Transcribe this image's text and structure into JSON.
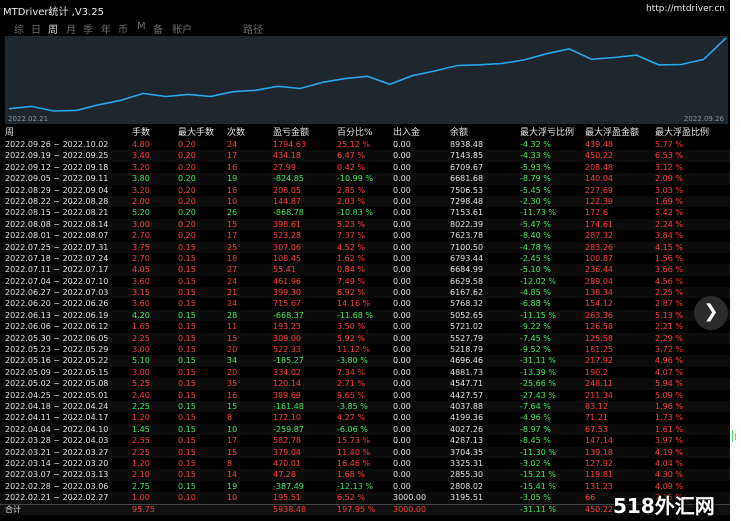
{
  "window": {
    "title": "MTDriver统计 ,V3.25",
    "url": "http://mtdriver.cn"
  },
  "tabs": [
    "综",
    "日",
    "周",
    "月",
    "季",
    "年",
    "币",
    "M",
    "备",
    "账户",
    "",
    "路径"
  ],
  "active_tab": 2,
  "chart": {
    "start_date": "2022.02.21",
    "end_date": "2022.09.26",
    "line_color": "#2aa7e8"
  },
  "headers": [
    "周",
    "手数",
    "最大手数",
    "次数",
    "盈亏金额",
    "百分比%",
    "出入金",
    "余额",
    "最大浮亏比例",
    "最大浮盈金额",
    "最大浮盈比例"
  ],
  "rows": [
    [
      "2022.09.26 ~ 2022.10.02",
      "4.80",
      "0.20",
      "24",
      "1794.63",
      "25.12 %",
      "0.00",
      "8938.48",
      "-4.32 %",
      "439.48",
      "5.77 %"
    ],
    [
      "2022.09.19 ~ 2022.09.25",
      "3.40",
      "0.20",
      "17",
      "434.18",
      "6.47 %",
      "0.00",
      "7143.85",
      "-4.33 %",
      "450.22",
      "6.53 %"
    ],
    [
      "2022.09.12 ~ 2022.09.18",
      "3.20",
      "0.20",
      "16",
      "27.99",
      "0.42 %",
      "0.00",
      "6709.67",
      "-5.93 %",
      "208.48",
      "3.12 %"
    ],
    [
      "2022.09.05 ~ 2022.09.11",
      "3.80",
      "0.20",
      "19",
      "-824.85",
      "-10.99 %",
      "0.00",
      "6681.68",
      "-8.79 %",
      "140.04",
      "2.09 %"
    ],
    [
      "2022.08.29 ~ 2022.09.04",
      "3.20",
      "0.20",
      "16",
      "208.05",
      "2.85 %",
      "0.00",
      "7506.53",
      "-5.45 %",
      "227.69",
      "3.03 %"
    ],
    [
      "2022.08.22 ~ 2022.08.28",
      "2.00",
      "0.20",
      "10",
      "144.87",
      "2.03 %",
      "0.00",
      "7298.48",
      "-2.30 %",
      "122.39",
      "1.69 %"
    ],
    [
      "2022.08.15 ~ 2022.08.21",
      "5.20",
      "0.20",
      "26",
      "-868.78",
      "-10.83 %",
      "0.00",
      "7153.61",
      "-11.73 %",
      "172.6",
      "2.42 %"
    ],
    [
      "2022.08.08 ~ 2022.08.14",
      "3.00",
      "0.20",
      "15",
      "398.61",
      "5.23 %",
      "0.00",
      "8022.39",
      "-5.47 %",
      "174.61",
      "2.24 %"
    ],
    [
      "2022.08.01 ~ 2022.08.07",
      "2.70",
      "0.20",
      "17",
      "523.28",
      "7.37 %",
      "0.00",
      "7623.78",
      "-8.40 %",
      "287.32",
      "3.84 %"
    ],
    [
      "2022.07.25 ~ 2022.07.31",
      "3.75",
      "0.15",
      "25",
      "307.06",
      "4.52 %",
      "0.00",
      "7100.50",
      "-4.78 %",
      "283.26",
      "4.15 %"
    ],
    [
      "2022.07.18 ~ 2022.07.24",
      "2.70",
      "0.15",
      "18",
      "108.45",
      "1.62 %",
      "0.00",
      "6793.44",
      "-2.45 %",
      "100.87",
      "1.56 %"
    ],
    [
      "2022.07.11 ~ 2022.07.17",
      "4.05",
      "0.15",
      "27",
      "55.41",
      "0.84 %",
      "0.00",
      "6684.99",
      "-5.10 %",
      "236.44",
      "3.66 %"
    ],
    [
      "2022.07.04 ~ 2022.07.10",
      "3.60",
      "0.15",
      "24",
      "461.96",
      "7.49 %",
      "0.00",
      "6629.58",
      "-12.02 %",
      "289.04",
      "4.56 %"
    ],
    [
      "2022.06.27 ~ 2022.07.03",
      "3.15",
      "0.15",
      "21",
      "399.30",
      "6.92 %",
      "0.00",
      "6167.62",
      "-4.85 %",
      "138.34",
      "2.25 %"
    ],
    [
      "2022.06.20 ~ 2022.06.26",
      "3.60",
      "0.15",
      "24",
      "715.67",
      "14.16 %",
      "0.00",
      "5768.32",
      "-6.88 %",
      "154.12",
      "2.87 %"
    ],
    [
      "2022.06.13 ~ 2022.06.19",
      "4.20",
      "0.15",
      "28",
      "-668.37",
      "-11.68 %",
      "0.00",
      "5052.65",
      "-11.15 %",
      "263.36",
      "5.13 %"
    ],
    [
      "2022.06.06 ~ 2022.06.12",
      "1.65",
      "0.15",
      "11",
      "193.23",
      "3.50 %",
      "0.00",
      "5721.02",
      "-9.22 %",
      "126.58",
      "2.21 %"
    ],
    [
      "2022.05.30 ~ 2022.06.05",
      "2.25",
      "0.15",
      "15",
      "309.00",
      "5.92 %",
      "0.00",
      "5527.79",
      "-7.45 %",
      "125.58",
      "2.29 %"
    ],
    [
      "2022.05.23 ~ 2022.05.29",
      "3.00",
      "0.15",
      "20",
      "522.33",
      "11.12 %",
      "0.00",
      "5218.79",
      "-9.52 %",
      "181.25",
      "3.72 %"
    ],
    [
      "2022.05.16 ~ 2022.05.22",
      "5.10",
      "0.15",
      "34",
      "-185.27",
      "-3.80 %",
      "0.00",
      "4696.46",
      "-31.11 %",
      "217.92",
      "4.96 %"
    ],
    [
      "2022.05.09 ~ 2022.05.15",
      "3.00",
      "0.15",
      "20",
      "334.02",
      "7.34 %",
      "0.00",
      "4881.73",
      "-13.39 %",
      "190.2",
      "4.07 %"
    ],
    [
      "2022.05.02 ~ 2022.05.08",
      "5.25",
      "0.15",
      "35",
      "120.14",
      "2.71 %",
      "0.00",
      "4547.71",
      "-25.66 %",
      "248.11",
      "5.94 %"
    ],
    [
      "2022.04.25 ~ 2022.05.01",
      "2.40",
      "0.15",
      "16",
      "389.69",
      "9.65 %",
      "0.00",
      "4427.57",
      "-27.43 %",
      "211.34",
      "5.09 %"
    ],
    [
      "2022.04.18 ~ 2022.04.24",
      "2.25",
      "0.15",
      "15",
      "-161.48",
      "-3.85 %",
      "0.00",
      "4037.88",
      "-7.64 %",
      "83.12",
      "1.96 %"
    ],
    [
      "2022.04.11 ~ 2022.04.17",
      "1.20",
      "0.15",
      "8",
      "172.10",
      "4.27 %",
      "0.00",
      "4199.36",
      "-4.96 %",
      "71.21",
      "1.73 %"
    ],
    [
      "2022.04.04 ~ 2022.04.10",
      "1.45",
      "0.15",
      "10",
      "-259.87",
      "-6.06 %",
      "0.00",
      "4027.26",
      "-8.97 %",
      "67.53",
      "1.61 %"
    ],
    [
      "2022.03.28 ~ 2022.04.03",
      "2.55",
      "0.15",
      "17",
      "582.78",
      "15.73 %",
      "0.00",
      "4287.13",
      "-8.45 %",
      "147.14",
      "3.97 %"
    ],
    [
      "2022.03.21 ~ 2022.03.27",
      "2.25",
      "0.15",
      "15",
      "379.04",
      "11.40 %",
      "0.00",
      "3704.35",
      "-11.30 %",
      "139.18",
      "4.19 %"
    ],
    [
      "2022.03.14 ~ 2022.03.20",
      "1.20",
      "0.15",
      "8",
      "470.01",
      "16.46 %",
      "0.00",
      "3325.31",
      "-3.02 %",
      "127.92",
      "4.04 %"
    ],
    [
      "2022.03.07 ~ 2022.03.13",
      "2.10",
      "0.15",
      "14",
      "47.28",
      "1.68 %",
      "0.00",
      "2855.30",
      "-15.21 %",
      "119.81",
      "4.30 %"
    ],
    [
      "2022.02.28 ~ 2022.03.06",
      "2.75",
      "0.15",
      "19",
      "-387.49",
      "-12.13 %",
      "0.00",
      "2808.02",
      "-15.41 %",
      "131.23",
      "4.09 %"
    ],
    [
      "2022.02.21 ~ 2022.02.27",
      "1.00",
      "0.10",
      "10",
      "195.51",
      "6.52 %",
      "3000.00",
      "3195.51",
      "-3.05 %",
      "66",
      "2.15 %"
    ]
  ],
  "summary": [
    "合计",
    "95.75",
    "",
    "",
    "5938.48",
    "197.95 %",
    "3000.00",
    "",
    "-31.11 %",
    "450.22",
    ""
  ],
  "equity": [
    3000,
    3195.51,
    2808.02,
    2855.3,
    3325.31,
    3704.35,
    4287.13,
    4027.26,
    4199.36,
    4037.88,
    4427.57,
    4547.71,
    4881.73,
    4696.46,
    5218.79,
    5527.79,
    5721.02,
    5052.65,
    5768.32,
    6167.62,
    6629.58,
    6684.99,
    6793.44,
    7100.5,
    7623.78,
    8022.39,
    7153.61,
    7298.48,
    7506.53,
    6681.68,
    6709.67,
    7143.85,
    8938.48
  ],
  "watermark": {
    "text": "518外汇网",
    "k": "外"
  }
}
